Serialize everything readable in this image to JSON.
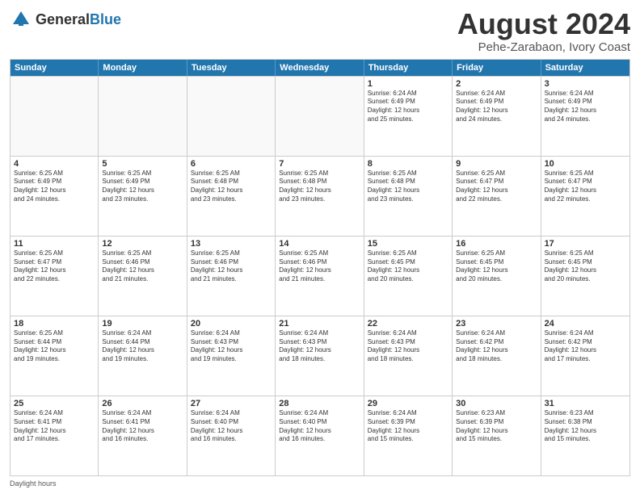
{
  "logo": {
    "general": "General",
    "blue": "Blue"
  },
  "title": "August 2024",
  "subtitle": "Pehe-Zarabaon, Ivory Coast",
  "days": [
    "Sunday",
    "Monday",
    "Tuesday",
    "Wednesday",
    "Thursday",
    "Friday",
    "Saturday"
  ],
  "weeks": [
    [
      {
        "day": "",
        "text": "",
        "empty": true
      },
      {
        "day": "",
        "text": "",
        "empty": true
      },
      {
        "day": "",
        "text": "",
        "empty": true
      },
      {
        "day": "",
        "text": "",
        "empty": true
      },
      {
        "day": "1",
        "text": "Sunrise: 6:24 AM\nSunset: 6:49 PM\nDaylight: 12 hours\nand 25 minutes."
      },
      {
        "day": "2",
        "text": "Sunrise: 6:24 AM\nSunset: 6:49 PM\nDaylight: 12 hours\nand 24 minutes."
      },
      {
        "day": "3",
        "text": "Sunrise: 6:24 AM\nSunset: 6:49 PM\nDaylight: 12 hours\nand 24 minutes."
      }
    ],
    [
      {
        "day": "4",
        "text": "Sunrise: 6:25 AM\nSunset: 6:49 PM\nDaylight: 12 hours\nand 24 minutes."
      },
      {
        "day": "5",
        "text": "Sunrise: 6:25 AM\nSunset: 6:49 PM\nDaylight: 12 hours\nand 23 minutes."
      },
      {
        "day": "6",
        "text": "Sunrise: 6:25 AM\nSunset: 6:48 PM\nDaylight: 12 hours\nand 23 minutes."
      },
      {
        "day": "7",
        "text": "Sunrise: 6:25 AM\nSunset: 6:48 PM\nDaylight: 12 hours\nand 23 minutes."
      },
      {
        "day": "8",
        "text": "Sunrise: 6:25 AM\nSunset: 6:48 PM\nDaylight: 12 hours\nand 23 minutes."
      },
      {
        "day": "9",
        "text": "Sunrise: 6:25 AM\nSunset: 6:47 PM\nDaylight: 12 hours\nand 22 minutes."
      },
      {
        "day": "10",
        "text": "Sunrise: 6:25 AM\nSunset: 6:47 PM\nDaylight: 12 hours\nand 22 minutes."
      }
    ],
    [
      {
        "day": "11",
        "text": "Sunrise: 6:25 AM\nSunset: 6:47 PM\nDaylight: 12 hours\nand 22 minutes."
      },
      {
        "day": "12",
        "text": "Sunrise: 6:25 AM\nSunset: 6:46 PM\nDaylight: 12 hours\nand 21 minutes."
      },
      {
        "day": "13",
        "text": "Sunrise: 6:25 AM\nSunset: 6:46 PM\nDaylight: 12 hours\nand 21 minutes."
      },
      {
        "day": "14",
        "text": "Sunrise: 6:25 AM\nSunset: 6:46 PM\nDaylight: 12 hours\nand 21 minutes."
      },
      {
        "day": "15",
        "text": "Sunrise: 6:25 AM\nSunset: 6:45 PM\nDaylight: 12 hours\nand 20 minutes."
      },
      {
        "day": "16",
        "text": "Sunrise: 6:25 AM\nSunset: 6:45 PM\nDaylight: 12 hours\nand 20 minutes."
      },
      {
        "day": "17",
        "text": "Sunrise: 6:25 AM\nSunset: 6:45 PM\nDaylight: 12 hours\nand 20 minutes."
      }
    ],
    [
      {
        "day": "18",
        "text": "Sunrise: 6:25 AM\nSunset: 6:44 PM\nDaylight: 12 hours\nand 19 minutes."
      },
      {
        "day": "19",
        "text": "Sunrise: 6:24 AM\nSunset: 6:44 PM\nDaylight: 12 hours\nand 19 minutes."
      },
      {
        "day": "20",
        "text": "Sunrise: 6:24 AM\nSunset: 6:43 PM\nDaylight: 12 hours\nand 19 minutes."
      },
      {
        "day": "21",
        "text": "Sunrise: 6:24 AM\nSunset: 6:43 PM\nDaylight: 12 hours\nand 18 minutes."
      },
      {
        "day": "22",
        "text": "Sunrise: 6:24 AM\nSunset: 6:43 PM\nDaylight: 12 hours\nand 18 minutes."
      },
      {
        "day": "23",
        "text": "Sunrise: 6:24 AM\nSunset: 6:42 PM\nDaylight: 12 hours\nand 18 minutes."
      },
      {
        "day": "24",
        "text": "Sunrise: 6:24 AM\nSunset: 6:42 PM\nDaylight: 12 hours\nand 17 minutes."
      }
    ],
    [
      {
        "day": "25",
        "text": "Sunrise: 6:24 AM\nSunset: 6:41 PM\nDaylight: 12 hours\nand 17 minutes."
      },
      {
        "day": "26",
        "text": "Sunrise: 6:24 AM\nSunset: 6:41 PM\nDaylight: 12 hours\nand 16 minutes."
      },
      {
        "day": "27",
        "text": "Sunrise: 6:24 AM\nSunset: 6:40 PM\nDaylight: 12 hours\nand 16 minutes."
      },
      {
        "day": "28",
        "text": "Sunrise: 6:24 AM\nSunset: 6:40 PM\nDaylight: 12 hours\nand 16 minutes."
      },
      {
        "day": "29",
        "text": "Sunrise: 6:24 AM\nSunset: 6:39 PM\nDaylight: 12 hours\nand 15 minutes."
      },
      {
        "day": "30",
        "text": "Sunrise: 6:23 AM\nSunset: 6:39 PM\nDaylight: 12 hours\nand 15 minutes."
      },
      {
        "day": "31",
        "text": "Sunrise: 6:23 AM\nSunset: 6:38 PM\nDaylight: 12 hours\nand 15 minutes."
      }
    ]
  ],
  "footer": {
    "daylight_label": "Daylight hours"
  }
}
